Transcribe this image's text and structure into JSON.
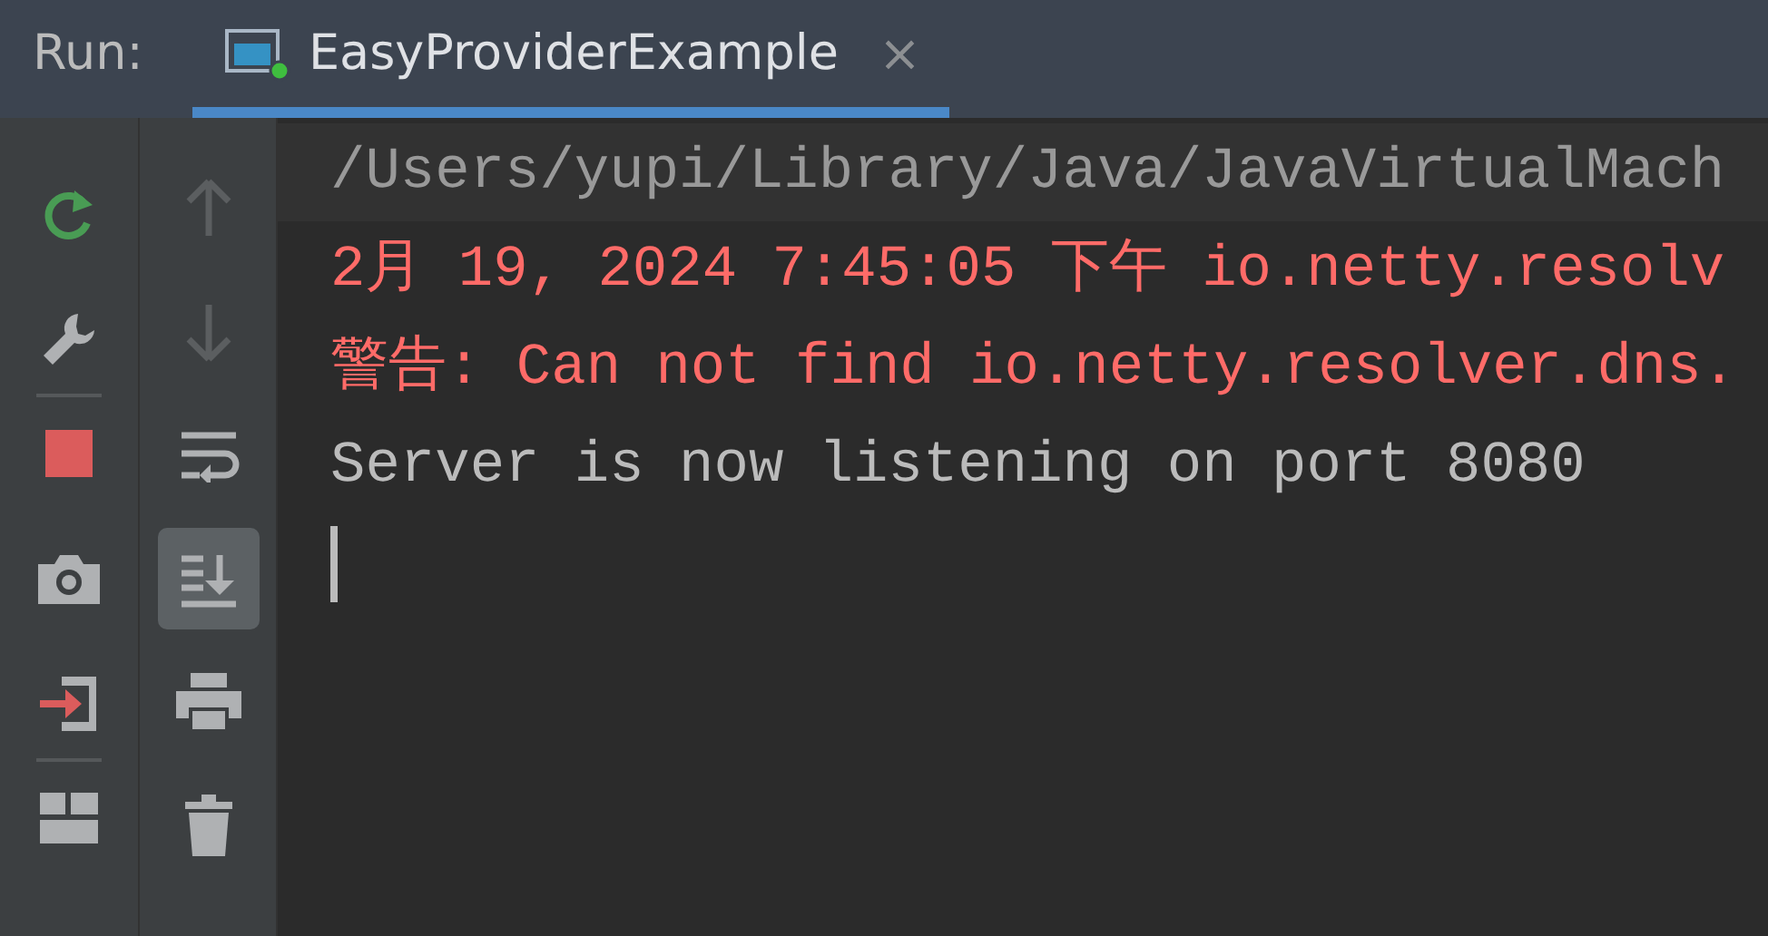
{
  "run_label": "Run:",
  "tab": {
    "label": "EasyProviderExample",
    "selected": true,
    "close": "×"
  },
  "left_toolbar": [
    {
      "kind": "rerun"
    },
    {
      "kind": "settings"
    },
    {
      "kind": "separator"
    },
    {
      "kind": "stop"
    },
    {
      "kind": "camera"
    },
    {
      "kind": "exit"
    },
    {
      "kind": "separator"
    },
    {
      "kind": "layout"
    }
  ],
  "console_toolbar": [
    {
      "kind": "up",
      "disabled": true,
      "selected": false
    },
    {
      "kind": "down",
      "disabled": true,
      "selected": false
    },
    {
      "kind": "wrap",
      "disabled": false,
      "selected": false
    },
    {
      "kind": "scroll-end",
      "disabled": false,
      "selected": true
    },
    {
      "kind": "print",
      "disabled": false,
      "selected": false
    },
    {
      "kind": "trash",
      "disabled": false,
      "selected": false
    }
  ],
  "console_lines": [
    {
      "kind": "command",
      "text": "/Users/yupi/Library/Java/JavaVirtualMach"
    },
    {
      "kind": "error",
      "text": "2月 19, 2024 7:45:05 下午 io.netty.resolv"
    },
    {
      "kind": "error",
      "text": "警告: Can not find io.netty.resolver.dns."
    },
    {
      "kind": "output",
      "text": "Server is now listening on port 8080"
    }
  ],
  "cursor": true
}
